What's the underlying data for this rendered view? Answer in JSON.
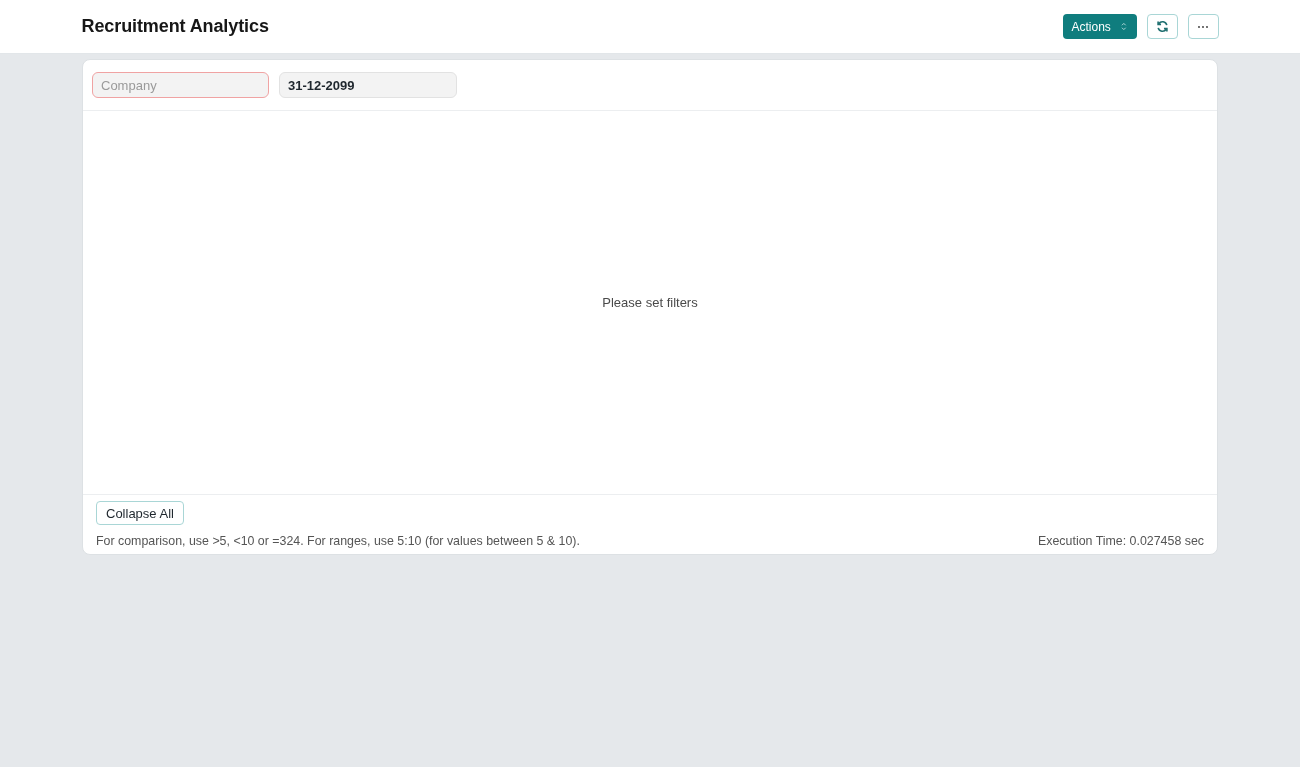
{
  "page": {
    "title": "Recruitment Analytics",
    "actions_button": {
      "label": "Actions"
    }
  },
  "filters": [
    {
      "placeholder": "Company",
      "invalid": true
    },
    {
      "value": "31-12-2099",
      "invalid": false
    }
  ],
  "report": {
    "message": "Please set filters"
  },
  "footer": {
    "collapse_button": "Collapse All",
    "help_text": "For comparison, use >5, <10 or =324. For ranges, use 5:10 (for values between 5 & 10).",
    "execution_time": "Execution Time: 0.027458 sec"
  }
}
